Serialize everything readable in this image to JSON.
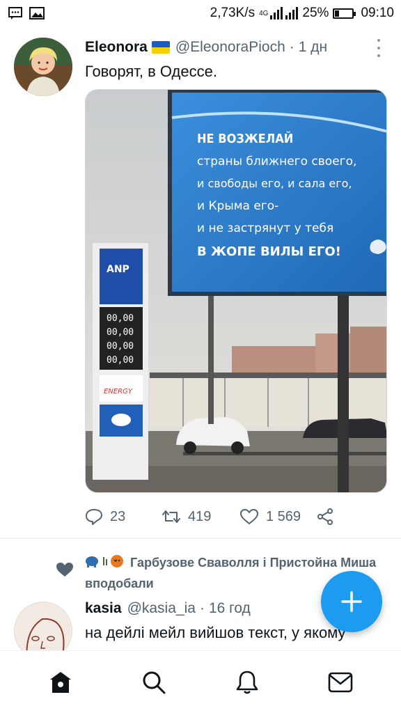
{
  "status_bar": {
    "network_speed": "2,73K/s",
    "network_type": "4G",
    "battery_percent": "25%",
    "battery_level": 0.25,
    "time": "09:10",
    "icons": [
      "message-icon",
      "image-icon",
      "signal-icon",
      "battery-icon"
    ]
  },
  "tweet": {
    "display_name": "Eleonora",
    "flag_icon": "ukraine-flag-icon",
    "handle": "@EleonoraPioch",
    "separator": "·",
    "time": "1 дн",
    "text": "Говорят, в Одессе.",
    "media": {
      "billboard_lines": [
        "НЕ ВОЗЖЕЛАЙ",
        "страны ближнего своего,",
        "и свободы его, и сала его,",
        "и Крыма его-",
        "и не застрянут у тебя",
        "В ЖОПЕ ВИЛЫ ЕГО!"
      ],
      "sign_brand": "ANP",
      "sign_prices": [
        "00,00",
        "00,00",
        "00,00",
        "00,00"
      ],
      "sign_energy": "ENERGY"
    },
    "actions": {
      "replies": "23",
      "retweets": "419",
      "likes": "1 569"
    }
  },
  "social_context": {
    "text": "Гарбузове Сваволля і Пристойна Миша вподобали"
  },
  "tweet2": {
    "display_name": "kasia",
    "handle": "@kasia_ia",
    "separator": "·",
    "time": "16 год",
    "text": "на дейлі мейл вийшов текст, у якому"
  },
  "colors": {
    "accent": "#1d9bf0",
    "secondary_text": "#536471",
    "primary_text": "#0f1419",
    "billboard_blue": "#2e86d6"
  },
  "bottom_nav": [
    "home-icon",
    "search-icon",
    "notifications-icon",
    "messages-icon"
  ]
}
